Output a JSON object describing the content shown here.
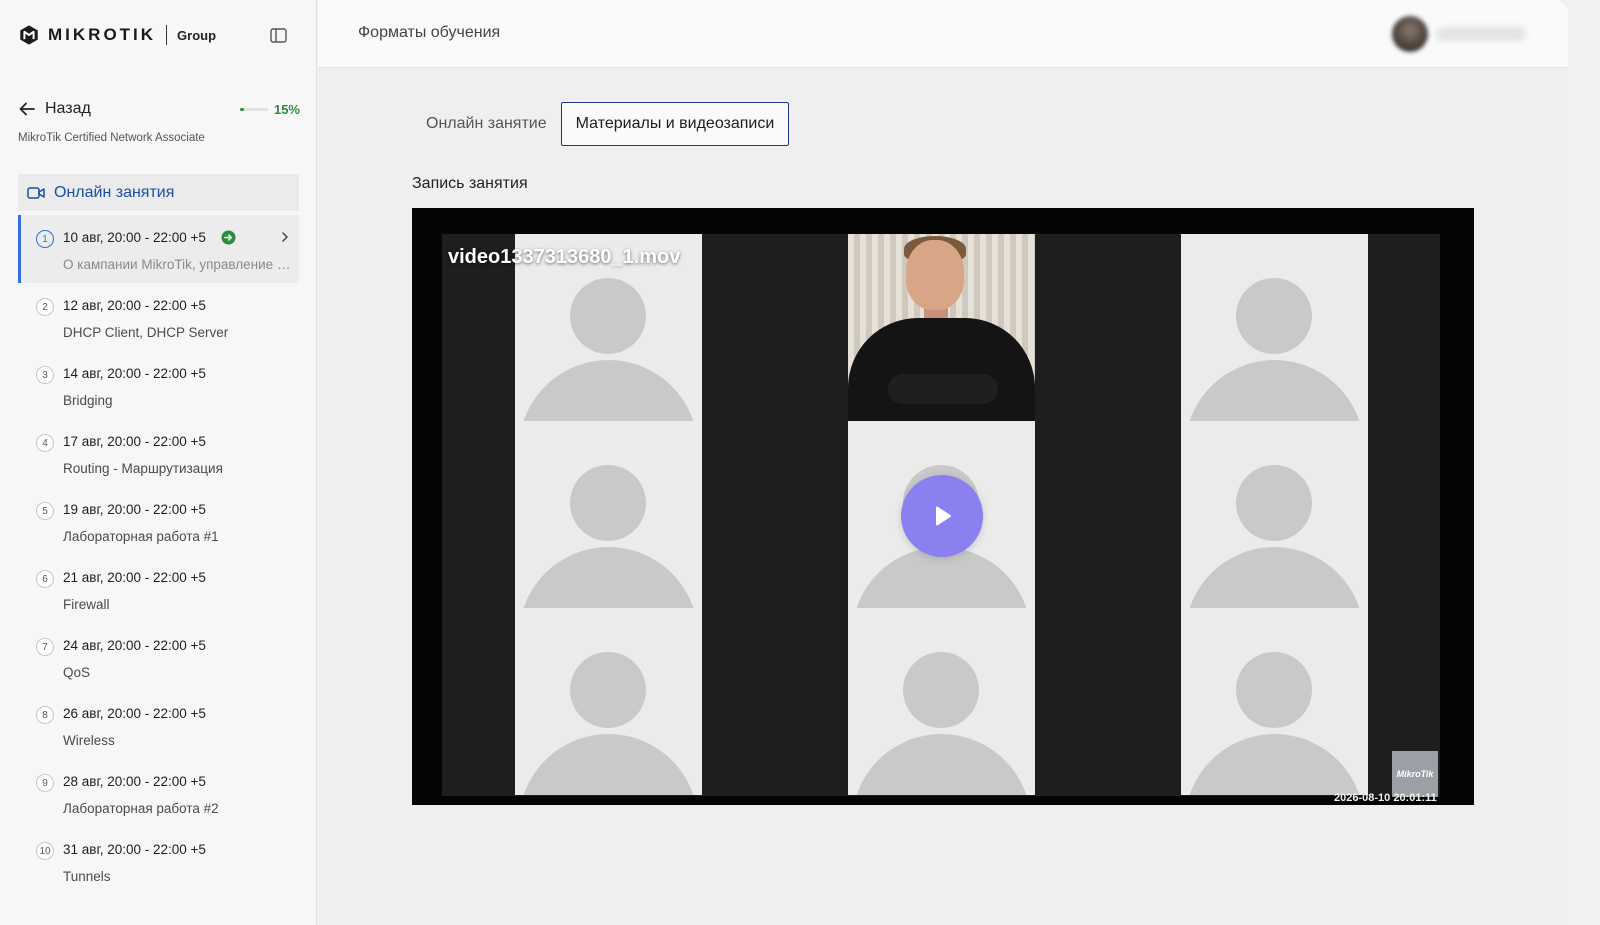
{
  "brand": {
    "wordmark": "MIKROTIK",
    "group": "Group"
  },
  "nav": {
    "back_label": "Назад",
    "progress_text": "15%",
    "progress_fraction": 0.15,
    "course_name": "MikroTik Certified Network Associate",
    "section_label": "Онлайн занятия"
  },
  "lessons": [
    {
      "num": "1",
      "date": "10 авг, 20:00 - 22:00 +5",
      "topic": "О кампании MikroTik, управление устройствами",
      "active": true,
      "done": true
    },
    {
      "num": "2",
      "date": "12 авг, 20:00 - 22:00 +5",
      "topic": "DHCP Client, DHCP Server"
    },
    {
      "num": "3",
      "date": "14 авг, 20:00 - 22:00 +5",
      "topic": "Bridging"
    },
    {
      "num": "4",
      "date": "17 авг, 20:00 - 22:00 +5",
      "topic": "Routing - Маршрутизация"
    },
    {
      "num": "5",
      "date": "19 авг, 20:00 - 22:00 +5",
      "topic": "Лабораторная работа #1"
    },
    {
      "num": "6",
      "date": "21 авг, 20:00 - 22:00 +5",
      "topic": "Firewall"
    },
    {
      "num": "7",
      "date": "24 авг, 20:00 - 22:00 +5",
      "topic": "QoS"
    },
    {
      "num": "8",
      "date": "26 авг, 20:00 - 22:00 +5",
      "topic": "Wireless"
    },
    {
      "num": "9",
      "date": "28 авг, 20:00 - 22:00 +5",
      "topic": "Лабораторная работа #2"
    },
    {
      "num": "10",
      "date": "31 авг, 20:00 - 22:00 +5",
      "topic": "Tunnels"
    }
  ],
  "header": {
    "title": "Форматы обучения"
  },
  "tabs": [
    {
      "label": "Онлайн занятие",
      "active": false
    },
    {
      "label": "Материалы и видеозаписи",
      "active": true
    }
  ],
  "recording": {
    "title": "Запись занятия",
    "file_name": "video1337313680_1.mov",
    "timestamp": "2026-08-10 20:01:11",
    "watermark": "MikroTik"
  },
  "colors": {
    "accent_blue": "#2f6fe0",
    "link_blue": "#1a4fa3",
    "progress_green": "#2e8b3d",
    "play_purple": "#8a80f0"
  }
}
